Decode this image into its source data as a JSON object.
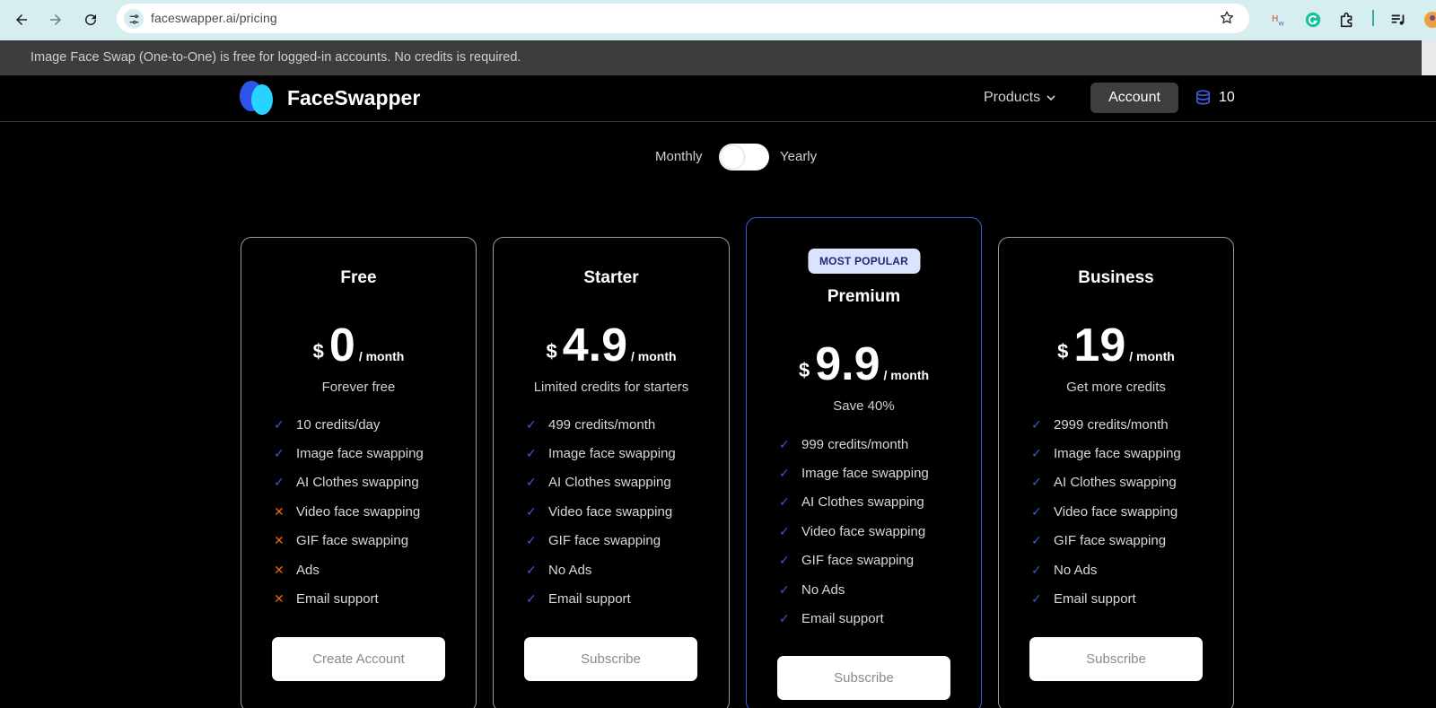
{
  "browser": {
    "url": "faceswapper.ai/pricing"
  },
  "announcement": {
    "text": "Image Face Swap (One-to-One) is free for logged-in accounts. No credits is required."
  },
  "header": {
    "brand": "FaceSwapper",
    "products_label": "Products",
    "account_label": "Account",
    "credits": "10"
  },
  "billing_toggle": {
    "left_label": "Monthly",
    "right_label": "Yearly"
  },
  "plans": [
    {
      "name": "Free",
      "currency": "$",
      "price": "0",
      "period": "/ month",
      "subtitle": "Forever free",
      "features": [
        {
          "text": "10 credits/day",
          "icon": "✓"
        },
        {
          "text": "Image face swapping",
          "icon": "✓"
        },
        {
          "text": "AI Clothes swapping",
          "icon": "✓"
        },
        {
          "text": "Video face swapping",
          "icon": "✕"
        },
        {
          "text": "GIF face swapping",
          "icon": "✕"
        },
        {
          "text": "Ads",
          "icon": "✕"
        },
        {
          "text": "Email support",
          "icon": "✕"
        }
      ],
      "cta": "Create Account"
    },
    {
      "name": "Starter",
      "currency": "$",
      "price": "4.9",
      "period": "/ month",
      "subtitle": "Limited credits for starters",
      "features": [
        {
          "text": "499 credits/month",
          "icon": "✓"
        },
        {
          "text": "Image face swapping",
          "icon": "✓"
        },
        {
          "text": "AI Clothes swapping",
          "icon": "✓"
        },
        {
          "text": "Video face swapping",
          "icon": "✓"
        },
        {
          "text": "GIF face swapping",
          "icon": "✓"
        },
        {
          "text": "No Ads",
          "icon": "✓"
        },
        {
          "text": "Email support",
          "icon": "✓"
        }
      ],
      "cta": "Subscribe"
    },
    {
      "name": "Premium",
      "badge": "MOST POPULAR",
      "currency": "$",
      "price": "9.9",
      "period": "/ month",
      "subtitle": "Save 40%",
      "features": [
        {
          "text": "999 credits/month",
          "icon": "✓"
        },
        {
          "text": "Image face swapping",
          "icon": "✓"
        },
        {
          "text": "AI Clothes swapping",
          "icon": "✓"
        },
        {
          "text": "Video face swapping",
          "icon": "✓"
        },
        {
          "text": "GIF face swapping",
          "icon": "✓"
        },
        {
          "text": "No Ads",
          "icon": "✓"
        },
        {
          "text": "Email support",
          "icon": "✓"
        }
      ],
      "cta": "Subscribe"
    },
    {
      "name": "Business",
      "currency": "$",
      "price": "19",
      "period": "/ month",
      "subtitle": "Get more credits",
      "features": [
        {
          "text": "2999 credits/month",
          "icon": "✓"
        },
        {
          "text": "Image face swapping",
          "icon": "✓"
        },
        {
          "text": "AI Clothes swapping",
          "icon": "✓"
        },
        {
          "text": "Video face swapping",
          "icon": "✓"
        },
        {
          "text": "GIF face swapping",
          "icon": "✓"
        },
        {
          "text": "No Ads",
          "icon": "✓"
        },
        {
          "text": "Email support",
          "icon": "✓"
        }
      ],
      "cta": "Subscribe"
    }
  ],
  "colors": {
    "accent": "#3b5bdb",
    "check": "#3b5bdb",
    "cross": "#e8651a",
    "badge_bg": "#dbe4ff"
  }
}
